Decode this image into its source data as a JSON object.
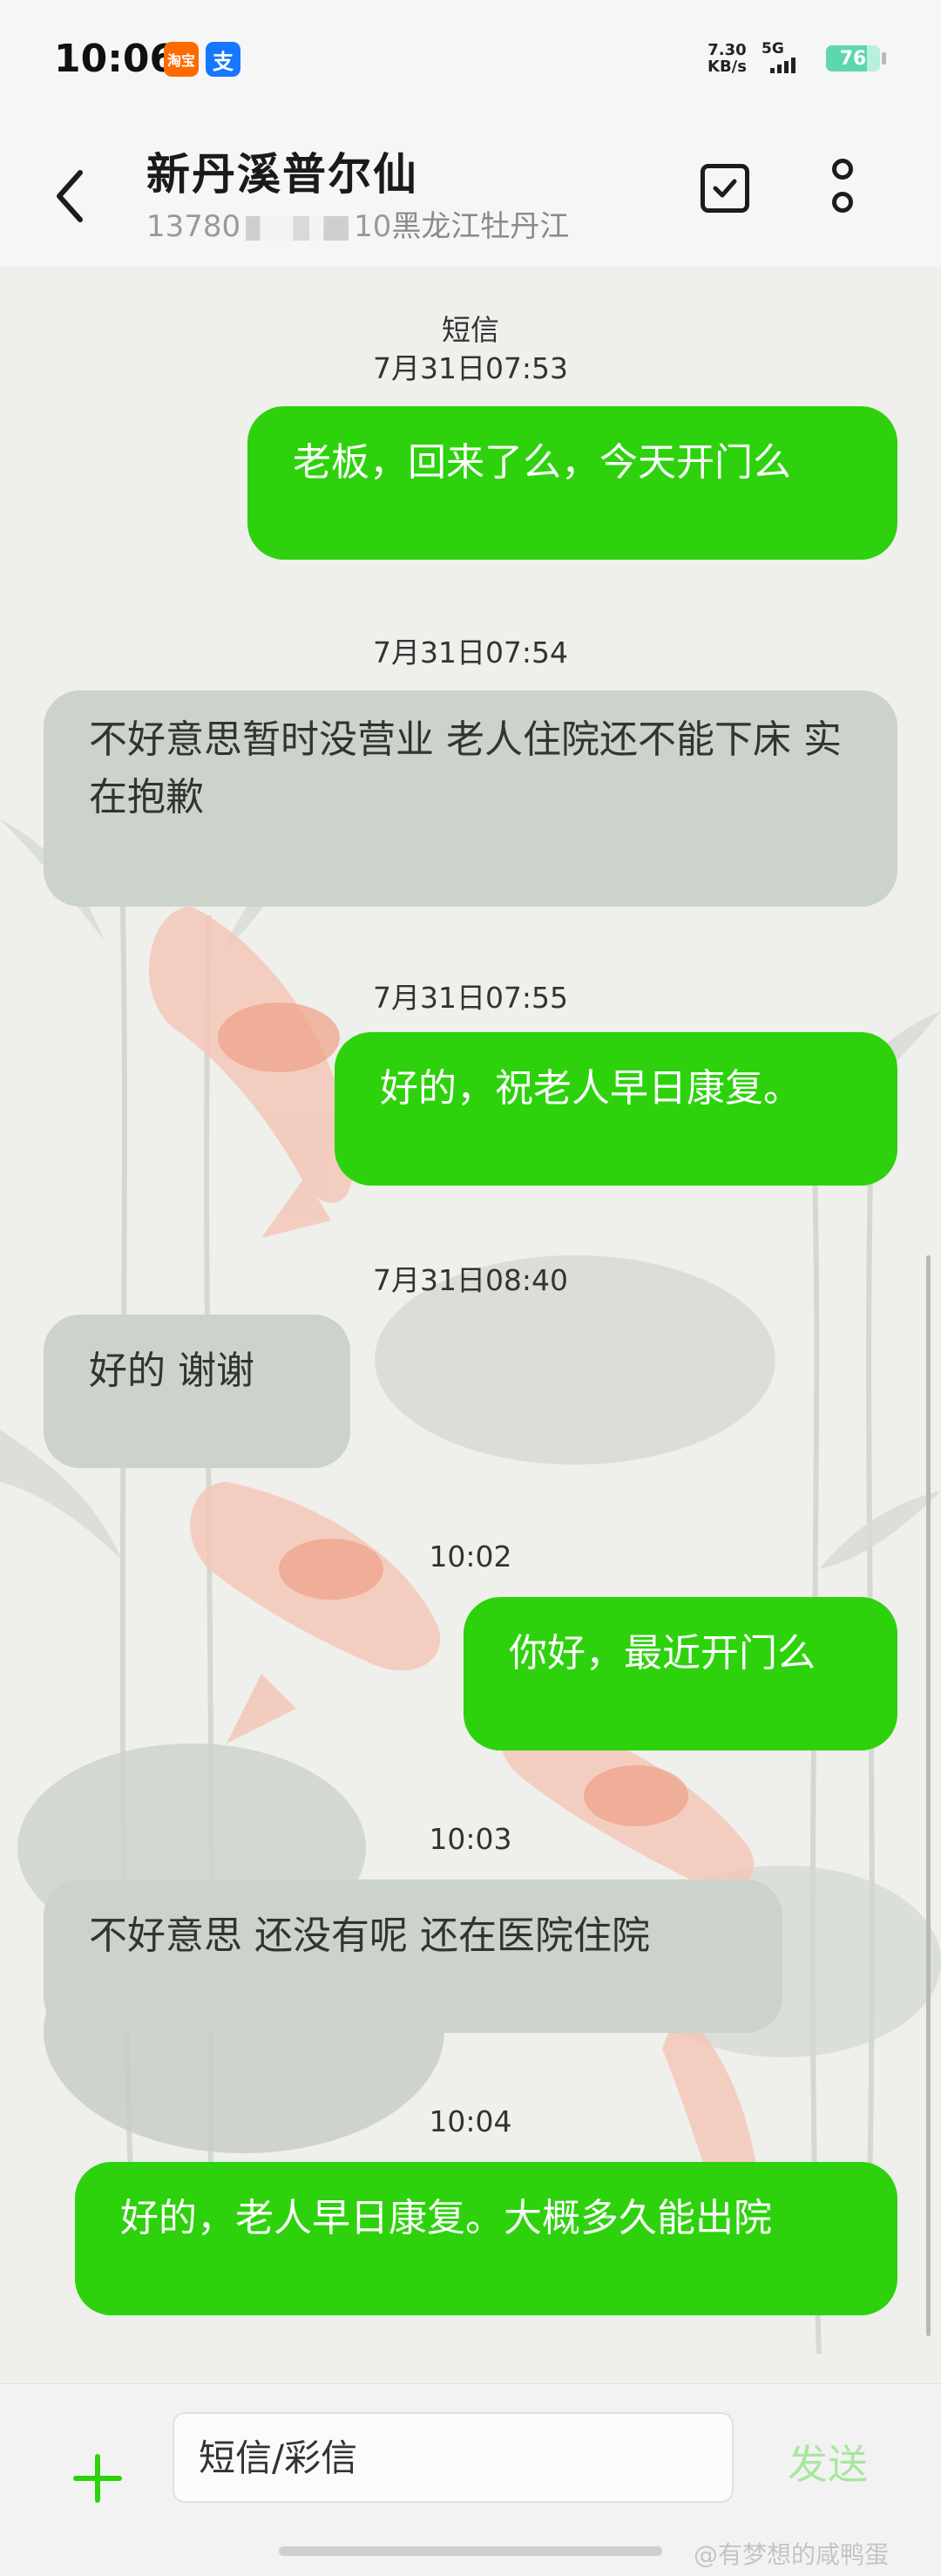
{
  "status_bar": {
    "time": "10:06",
    "app_icons": [
      {
        "name": "taobao-icon",
        "text": "淘宝"
      },
      {
        "name": "alipay-icon",
        "text": "支"
      }
    ],
    "net_speed_value": "7.30",
    "net_speed_unit": "KB/s",
    "network": "5G",
    "battery": "76",
    "battery_level": 0.76
  },
  "header": {
    "contact_name": "新丹溪普尔仙",
    "phone_prefix": "13780",
    "phone_suffix": "10",
    "location": "黑龙江牡丹江"
  },
  "conversation": [
    {
      "type": "label",
      "text": "短信"
    },
    {
      "type": "label",
      "text": "7月31日07:53"
    },
    {
      "type": "message",
      "direction": "out",
      "text": "老板，回来了么，今天开门么"
    },
    {
      "type": "label",
      "text": "7月31日07:54"
    },
    {
      "type": "message",
      "direction": "in",
      "text": "不好意思暂时没营业   老人住院还不能下床  实在抱歉"
    },
    {
      "type": "label",
      "text": "7月31日07:55"
    },
    {
      "type": "message",
      "direction": "out",
      "text": "好的，祝老人早日康复。"
    },
    {
      "type": "label",
      "text": "7月31日08:40"
    },
    {
      "type": "message",
      "direction": "in",
      "text": "好的    谢谢"
    },
    {
      "type": "label",
      "text": "10:02"
    },
    {
      "type": "message",
      "direction": "out",
      "text": "你好，最近开门么"
    },
    {
      "type": "label",
      "text": "10:03"
    },
    {
      "type": "message",
      "direction": "in",
      "text": "不好意思  还没有呢  还在医院住院"
    },
    {
      "type": "label",
      "text": "10:04"
    },
    {
      "type": "message",
      "direction": "out",
      "text": "好的，老人早日康复。大概多久能出院"
    }
  ],
  "composer": {
    "placeholder": "短信/彩信",
    "send_label": "发送"
  },
  "watermark": "@有梦想的咸鸭蛋",
  "colors": {
    "outgoing_bubble": "#2dd20d",
    "incoming_bubble": "#cbd3ca",
    "send_disabled": "#a9e6a0"
  }
}
